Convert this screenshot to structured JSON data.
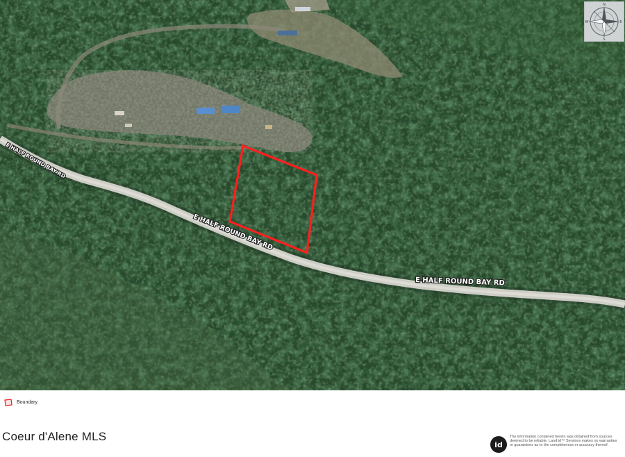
{
  "map": {
    "road_labels": [
      "E HALF ROUND BAY RD",
      "E HALF ROUND BAY RD",
      "E HALF ROUND BAY RD"
    ],
    "compass_icon": "compass-rose-icon",
    "colors": {
      "forest_dark": "#1f3d24",
      "forest_mid": "#2f5a34",
      "clearing": "#8e8a78",
      "road": "#cfcfc8",
      "boundary": "#ff2222"
    }
  },
  "legend": {
    "label": "Boundary",
    "icon": "boundary-polygon-icon"
  },
  "footer": {
    "brand": "Coeur d'Alene MLS",
    "logo_text": "id",
    "disclaimer": "The information contained herein was obtained from sources deemed to be reliable. Land.id™ Services makes no warranties or guarantees as to the completeness or accuracy thereof."
  }
}
